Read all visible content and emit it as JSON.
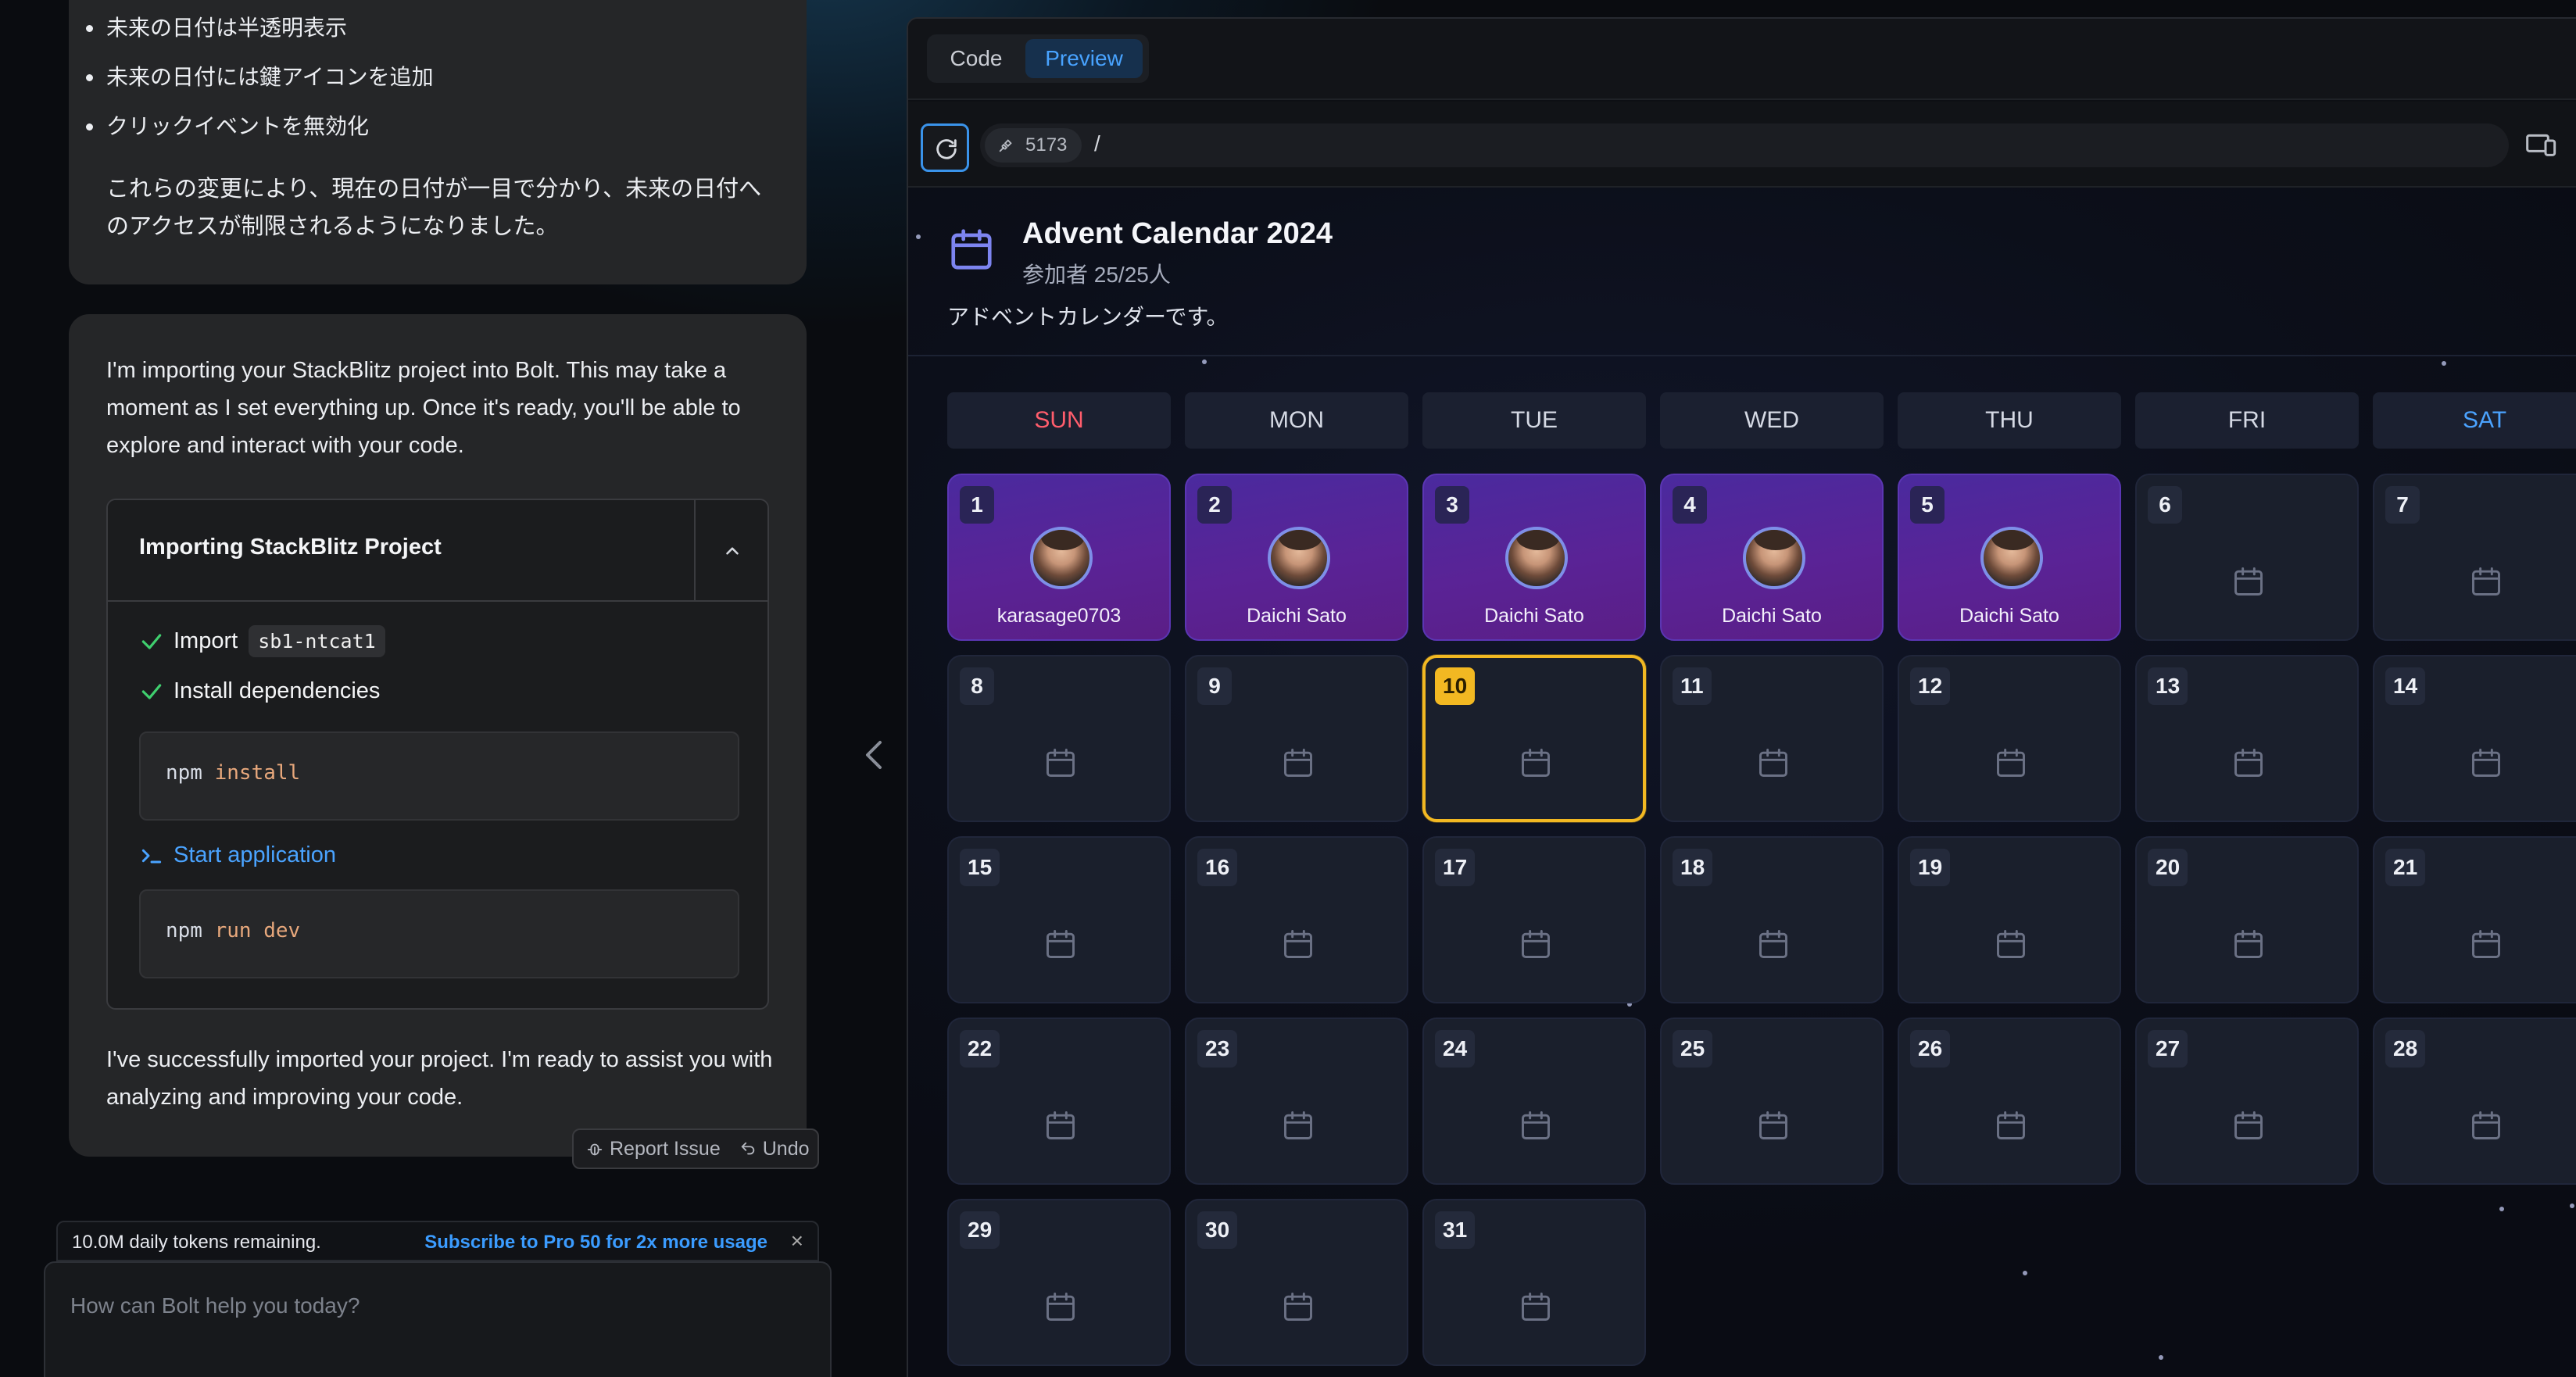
{
  "chat": {
    "bullets": [
      "未来の日付は半透明表示",
      "未来の日付には鍵アイコンを追加",
      "クリックイベントを無効化"
    ],
    "summary": "これらの変更により、現在の日付が一目で分かり、未来の日付へのアクセスが制限されるようになりました。",
    "importing_message": "I'm importing your StackBlitz project into Bolt. This may take a moment as I set everything up. Once it's ready, you'll be able to explore and interact with your code.",
    "artifact": {
      "title": "Importing StackBlitz Project",
      "steps": {
        "import_label": "Import",
        "import_tag": "sb1-ntcat1",
        "install_label": "Install dependencies",
        "install_cmd": "npm",
        "install_arg": "install",
        "start_label": "Start application",
        "start_cmd": "npm",
        "start_arg": "run dev"
      }
    },
    "done_message": "I've successfully imported your project. I'm ready to assist you with analyzing and improving your code.",
    "report_label": "Report Issue",
    "undo_label": "Undo",
    "tokens_text": "10.0M daily tokens remaining.",
    "subscribe_text": "Subscribe to Pro 50 for 2x more usage",
    "close_glyph": "×",
    "prompt_placeholder": "How can Bolt help you today?"
  },
  "workbench": {
    "tab_code": "Code",
    "tab_preview": "Preview",
    "port": "5173",
    "path": "/"
  },
  "app": {
    "title": "Advent Calendar 2024",
    "participants": "参加者 25/25人",
    "description": "アドベントカレンダーです。",
    "weekdays": [
      "SUN",
      "MON",
      "TUE",
      "WED",
      "THU",
      "FRI",
      "SAT"
    ],
    "today": 10,
    "entries": [
      {
        "day": 1,
        "author": "karasage0703"
      },
      {
        "day": 2,
        "author": "Daichi Sato"
      },
      {
        "day": 3,
        "author": "Daichi Sato"
      },
      {
        "day": 4,
        "author": "Daichi Sato"
      },
      {
        "day": 5,
        "author": "Daichi Sato"
      }
    ],
    "colors": {
      "accent": "#f2b822",
      "sunday": "#ff5d6c",
      "saturday": "#4ba3ff",
      "filled": "#5a2396",
      "link": "#3b9cff"
    }
  }
}
